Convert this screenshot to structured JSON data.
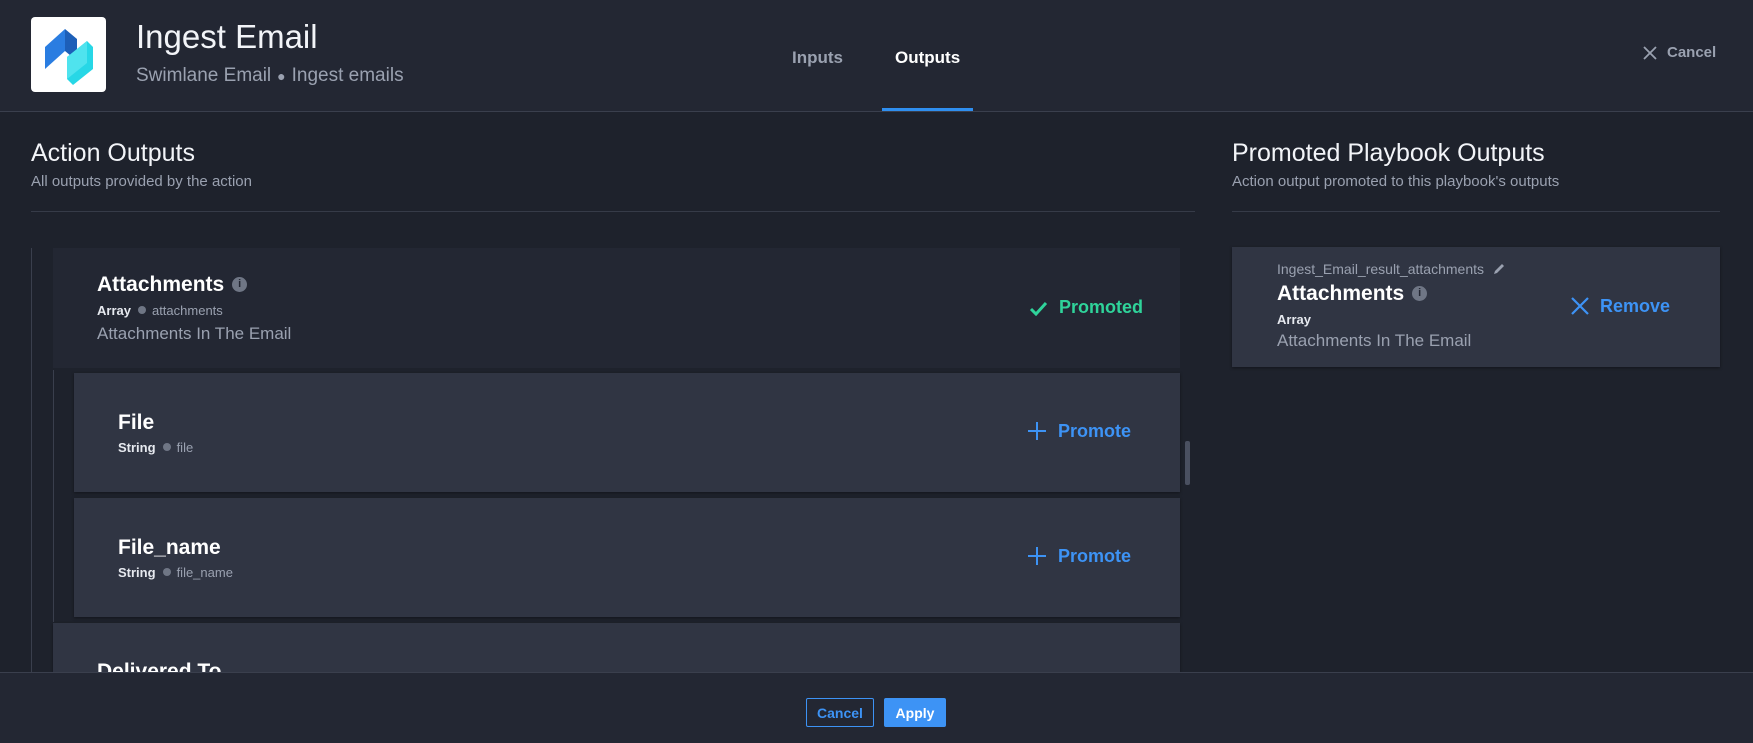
{
  "header": {
    "title": "Ingest Email",
    "subtitle_app": "Swimlane Email",
    "subtitle_action": "Ingest emails",
    "tabs": [
      {
        "label": "Inputs",
        "active": false
      },
      {
        "label": "Outputs",
        "active": true
      }
    ],
    "cancel_label": "Cancel",
    "logo_icon": "swimlane-logo-icon"
  },
  "action_outputs": {
    "title": "Action Outputs",
    "subtitle": "All outputs provided by the action",
    "items": [
      {
        "name": "Attachments",
        "type": "Array",
        "key": "attachments",
        "description": "Attachments In The Email",
        "status_label": "Promoted",
        "children": [
          {
            "name": "File",
            "type": "String",
            "key": "file",
            "action_label": "Promote"
          },
          {
            "name": "File_name",
            "type": "String",
            "key": "file_name",
            "action_label": "Promote"
          }
        ]
      },
      {
        "name": "Delivered To"
      }
    ]
  },
  "promoted_outputs": {
    "title": "Promoted Playbook Outputs",
    "subtitle": "Action output promoted to this playbook's outputs",
    "items": [
      {
        "key": "Ingest_Email_result_attachments",
        "name": "Attachments",
        "type": "Array",
        "description": "Attachments In The Email",
        "action_label": "Remove"
      }
    ]
  },
  "footer": {
    "cancel_label": "Cancel",
    "apply_label": "Apply"
  },
  "colors": {
    "accent": "#3d93f5",
    "promoted": "#2fd39a",
    "background": "#1e222c"
  }
}
